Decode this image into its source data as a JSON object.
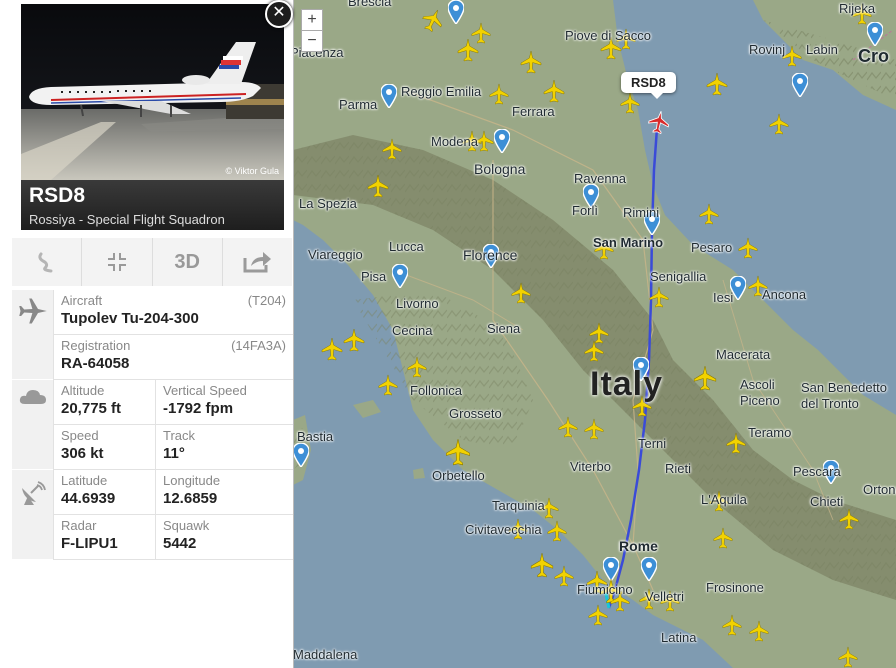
{
  "map": {
    "country_label": "Italy",
    "zoom_in": "+",
    "zoom_out": "−",
    "colors": {
      "sea": "#7f9bb1",
      "land": "#9aa887",
      "mountain": "#858d6e",
      "track": "#3a4bd8",
      "aircraft": "#f2d200",
      "selected_aircraft": "#d92b2b"
    },
    "cities": [
      {
        "name": "Brescia"
      },
      {
        "name": "Piove di Sacco"
      },
      {
        "name": "Rijeka"
      },
      {
        "name": "Rovinj"
      },
      {
        "name": "Labin"
      },
      {
        "name": "Cro"
      },
      {
        "name": "Piacenza"
      },
      {
        "name": "Reggio Emilia"
      },
      {
        "name": "Parma"
      },
      {
        "name": "Ferrara"
      },
      {
        "name": "Modena"
      },
      {
        "name": "Bologna"
      },
      {
        "name": "Ravenna"
      },
      {
        "name": "Forlì"
      },
      {
        "name": "La Spezia"
      },
      {
        "name": "Rimini"
      },
      {
        "name": "San Marino"
      },
      {
        "name": "Pesaro"
      },
      {
        "name": "Viareggio"
      },
      {
        "name": "Lucca"
      },
      {
        "name": "Florence"
      },
      {
        "name": "Pisa"
      },
      {
        "name": "Senigallia"
      },
      {
        "name": "Iesi"
      },
      {
        "name": "Ancona"
      },
      {
        "name": "Livorno"
      },
      {
        "name": "Cecina"
      },
      {
        "name": "Siena"
      },
      {
        "name": "Macerata"
      },
      {
        "name": "Follonica"
      },
      {
        "name": "Ascoli Piceno"
      },
      {
        "name": "San Benedetto del Tronto"
      },
      {
        "name": "Grosseto"
      },
      {
        "name": "Bastia"
      },
      {
        "name": "Terni"
      },
      {
        "name": "Teramo"
      },
      {
        "name": "Viterbo"
      },
      {
        "name": "Rieti"
      },
      {
        "name": "Orbetello"
      },
      {
        "name": "Pescara"
      },
      {
        "name": "Ortona"
      },
      {
        "name": "L'Aquila"
      },
      {
        "name": "Chieti"
      },
      {
        "name": "Tarquinia"
      },
      {
        "name": "Civitavecchia"
      },
      {
        "name": "Rome"
      },
      {
        "name": "Fiumicino"
      },
      {
        "name": "Velletri"
      },
      {
        "name": "Frosinone"
      },
      {
        "name": "Latina"
      },
      {
        "name": "Maddalena"
      }
    ]
  },
  "selected_flight": {
    "callsign": "RSD8",
    "airline": "Rossiya - Special Flight Squadron",
    "photo_credit": "© Viktor Gula",
    "aircraft_label": "Aircraft",
    "aircraft_value": "Tupolev Tu-204-300",
    "aircraft_code": "(T204)",
    "registration_label": "Registration",
    "registration_value": "RA-64058",
    "registration_code": "(14FA3A)",
    "altitude_label": "Altitude",
    "altitude_value": "20,775 ft",
    "vspeed_label": "Vertical Speed",
    "vspeed_value": "-1792 fpm",
    "speed_label": "Speed",
    "speed_value": "306 kt",
    "track_label": "Track",
    "track_value": "11°",
    "lat_label": "Latitude",
    "lat_value": "44.6939",
    "lon_label": "Longitude",
    "lon_value": "12.6859",
    "radar_label": "Radar",
    "radar_value": "F-LIPU1",
    "squawk_label": "Squawk",
    "squawk_value": "5442"
  },
  "actions": {
    "route_icon": "route-icon",
    "cockpit_icon": "collapse-icon",
    "view_3d_label": "3D",
    "share_icon": "share-icon"
  }
}
